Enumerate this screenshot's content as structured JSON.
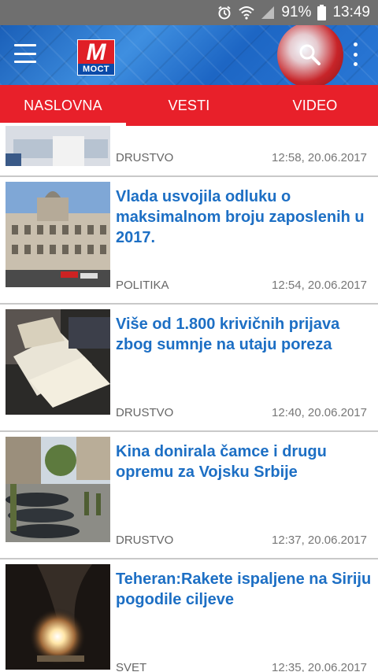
{
  "status_bar": {
    "battery": "91%",
    "time": "13:49"
  },
  "header": {
    "logo_letter": "M",
    "logo_word": "МОСТ"
  },
  "tabs": [
    {
      "label": "NASLOVNA",
      "active": true
    },
    {
      "label": "VESTI",
      "active": false
    },
    {
      "label": "VIDEO",
      "active": false
    }
  ],
  "articles": [
    {
      "title": "",
      "category": "DRUSTVO",
      "time": "12:58, 20.06.2017"
    },
    {
      "title": "Vlada usvojila odluku o maksimalnom broju zaposlenih u 2017.",
      "category": "POLITIKA",
      "time": "12:54, 20.06.2017"
    },
    {
      "title": "Više od 1.800 krivičnih prijava zbog sumnje na utaju poreza",
      "category": "DRUSTVO",
      "time": "12:40, 20.06.2017"
    },
    {
      "title": "Kina donirala čamce i drugu opremu za Vojsku Srbije",
      "category": "DRUSTVO",
      "time": "12:37, 20.06.2017"
    },
    {
      "title": "Teheran:Rakete ispaljene na Siriju pogodile ciljeve",
      "category": "SVET",
      "time": "12:35, 20.06.2017"
    }
  ],
  "colors": {
    "tab_bar": "#e8202a",
    "title_blue": "#1d6fc4",
    "status_bar": "#6f6f6f"
  }
}
